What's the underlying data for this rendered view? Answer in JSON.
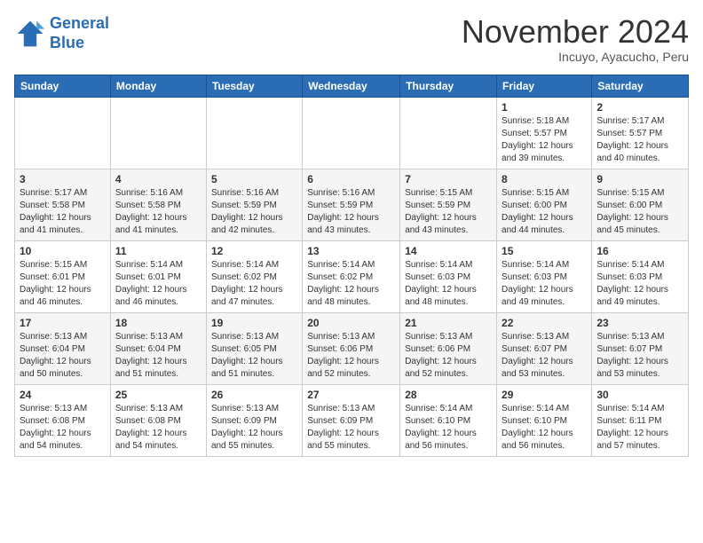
{
  "header": {
    "logo_line1": "General",
    "logo_line2": "Blue",
    "month": "November 2024",
    "location": "Incuyo, Ayacucho, Peru"
  },
  "weekdays": [
    "Sunday",
    "Monday",
    "Tuesday",
    "Wednesday",
    "Thursday",
    "Friday",
    "Saturday"
  ],
  "weeks": [
    [
      {
        "day": "",
        "info": ""
      },
      {
        "day": "",
        "info": ""
      },
      {
        "day": "",
        "info": ""
      },
      {
        "day": "",
        "info": ""
      },
      {
        "day": "",
        "info": ""
      },
      {
        "day": "1",
        "info": "Sunrise: 5:18 AM\nSunset: 5:57 PM\nDaylight: 12 hours\nand 39 minutes."
      },
      {
        "day": "2",
        "info": "Sunrise: 5:17 AM\nSunset: 5:57 PM\nDaylight: 12 hours\nand 40 minutes."
      }
    ],
    [
      {
        "day": "3",
        "info": "Sunrise: 5:17 AM\nSunset: 5:58 PM\nDaylight: 12 hours\nand 41 minutes."
      },
      {
        "day": "4",
        "info": "Sunrise: 5:16 AM\nSunset: 5:58 PM\nDaylight: 12 hours\nand 41 minutes."
      },
      {
        "day": "5",
        "info": "Sunrise: 5:16 AM\nSunset: 5:59 PM\nDaylight: 12 hours\nand 42 minutes."
      },
      {
        "day": "6",
        "info": "Sunrise: 5:16 AM\nSunset: 5:59 PM\nDaylight: 12 hours\nand 43 minutes."
      },
      {
        "day": "7",
        "info": "Sunrise: 5:15 AM\nSunset: 5:59 PM\nDaylight: 12 hours\nand 43 minutes."
      },
      {
        "day": "8",
        "info": "Sunrise: 5:15 AM\nSunset: 6:00 PM\nDaylight: 12 hours\nand 44 minutes."
      },
      {
        "day": "9",
        "info": "Sunrise: 5:15 AM\nSunset: 6:00 PM\nDaylight: 12 hours\nand 45 minutes."
      }
    ],
    [
      {
        "day": "10",
        "info": "Sunrise: 5:15 AM\nSunset: 6:01 PM\nDaylight: 12 hours\nand 46 minutes."
      },
      {
        "day": "11",
        "info": "Sunrise: 5:14 AM\nSunset: 6:01 PM\nDaylight: 12 hours\nand 46 minutes."
      },
      {
        "day": "12",
        "info": "Sunrise: 5:14 AM\nSunset: 6:02 PM\nDaylight: 12 hours\nand 47 minutes."
      },
      {
        "day": "13",
        "info": "Sunrise: 5:14 AM\nSunset: 6:02 PM\nDaylight: 12 hours\nand 48 minutes."
      },
      {
        "day": "14",
        "info": "Sunrise: 5:14 AM\nSunset: 6:03 PM\nDaylight: 12 hours\nand 48 minutes."
      },
      {
        "day": "15",
        "info": "Sunrise: 5:14 AM\nSunset: 6:03 PM\nDaylight: 12 hours\nand 49 minutes."
      },
      {
        "day": "16",
        "info": "Sunrise: 5:14 AM\nSunset: 6:03 PM\nDaylight: 12 hours\nand 49 minutes."
      }
    ],
    [
      {
        "day": "17",
        "info": "Sunrise: 5:13 AM\nSunset: 6:04 PM\nDaylight: 12 hours\nand 50 minutes."
      },
      {
        "day": "18",
        "info": "Sunrise: 5:13 AM\nSunset: 6:04 PM\nDaylight: 12 hours\nand 51 minutes."
      },
      {
        "day": "19",
        "info": "Sunrise: 5:13 AM\nSunset: 6:05 PM\nDaylight: 12 hours\nand 51 minutes."
      },
      {
        "day": "20",
        "info": "Sunrise: 5:13 AM\nSunset: 6:06 PM\nDaylight: 12 hours\nand 52 minutes."
      },
      {
        "day": "21",
        "info": "Sunrise: 5:13 AM\nSunset: 6:06 PM\nDaylight: 12 hours\nand 52 minutes."
      },
      {
        "day": "22",
        "info": "Sunrise: 5:13 AM\nSunset: 6:07 PM\nDaylight: 12 hours\nand 53 minutes."
      },
      {
        "day": "23",
        "info": "Sunrise: 5:13 AM\nSunset: 6:07 PM\nDaylight: 12 hours\nand 53 minutes."
      }
    ],
    [
      {
        "day": "24",
        "info": "Sunrise: 5:13 AM\nSunset: 6:08 PM\nDaylight: 12 hours\nand 54 minutes."
      },
      {
        "day": "25",
        "info": "Sunrise: 5:13 AM\nSunset: 6:08 PM\nDaylight: 12 hours\nand 54 minutes."
      },
      {
        "day": "26",
        "info": "Sunrise: 5:13 AM\nSunset: 6:09 PM\nDaylight: 12 hours\nand 55 minutes."
      },
      {
        "day": "27",
        "info": "Sunrise: 5:13 AM\nSunset: 6:09 PM\nDaylight: 12 hours\nand 55 minutes."
      },
      {
        "day": "28",
        "info": "Sunrise: 5:14 AM\nSunset: 6:10 PM\nDaylight: 12 hours\nand 56 minutes."
      },
      {
        "day": "29",
        "info": "Sunrise: 5:14 AM\nSunset: 6:10 PM\nDaylight: 12 hours\nand 56 minutes."
      },
      {
        "day": "30",
        "info": "Sunrise: 5:14 AM\nSunset: 6:11 PM\nDaylight: 12 hours\nand 57 minutes."
      }
    ]
  ]
}
